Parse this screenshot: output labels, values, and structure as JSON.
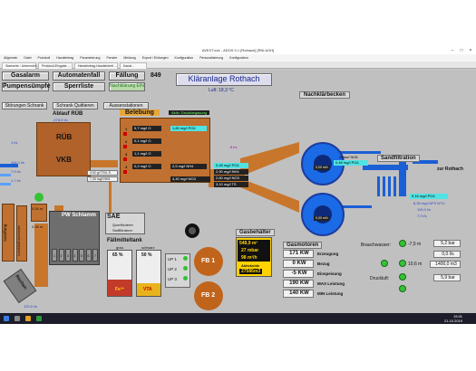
{
  "window": {
    "title": "AVEXT.exe - ADOS 9.1 [Rothach] [RNI AGH]",
    "menu": [
      "Allgemein",
      "Datei",
      "Protokoll",
      "Handeintrag",
      "Parameterung",
      "Fenster",
      "Meldung",
      "Export / Einfuegen",
      "Konfiguration",
      "Personalisierung",
      "Konfiguration"
    ],
    "tabs": [
      "Startseite / Uebersicht ...",
      "Protokoll-Eingabe ...",
      "Handeintrag-Handeinheit ...",
      "Kanal..."
    ]
  },
  "scada": {
    "buttons": {
      "gasalarm": "Gasalarm",
      "automatenfall": "Automatenfall",
      "faellung": "Fällung",
      "faellung_count": "849",
      "pumpensuempfe": "Pumpensümpfe",
      "sperrliste": "Sperrliste",
      "nachklaerung_ein": "Nachklärung EIN",
      "stoerungen": "Störungen Schrank",
      "schrank_quittieren": "Schrank Quittieren",
      "aussenstationen": "Aussenstationen"
    },
    "title": "Kläranlage Rothach",
    "luft": "Luft: 18,3 °C",
    "nachklaerbecken": "Nachklärbecken",
    "ablauf_rueb": "Ablauf RÜB",
    "ablauf_rueb_val": "-278,0 l/s",
    "rueb": "RÜB",
    "vkb": "VKB",
    "belebung": "Belebung",
    "belebung_state": "Aktiv: Druckbegasung",
    "left_vals": [
      "1 l/s",
      "119,0 l/s",
      "7,9 l/s",
      "1,7 l/s"
    ],
    "vkb_vals": [
      "3,92 g/l TS/L S",
      "7,30 mg/l NH4"
    ],
    "beleb_rows": [
      {
        "no": "1",
        "left": "9,7 mg/l O",
        "right": "1,80 mg/l PO4"
      },
      {
        "no": "2",
        "left": "0,1 mg/l O",
        "right": ""
      },
      {
        "no": "3",
        "left": "1,1 mg/l O",
        "right": ""
      },
      {
        "no": "4",
        "left": "0,2 mg/l O",
        "right": "2,5 mg/l NH4"
      }
    ],
    "beleb_extra": "4,40 mg/l NO3",
    "mid_vals": [
      "0,48 mg/l PO4",
      "2,90 mg/l NH4",
      "2,80 mg/l NO3",
      "3,10 mg/l TS"
    ],
    "side_val": "8 l/s",
    "becken1": "0,00 m/h",
    "becken2": "0,00 m/h",
    "ablauf_nkb": "Ablauf NKB",
    "ablauf_nkb_val": "0,48 mg/l PO4",
    "sandfiltration": "Sandfiltration",
    "zur_rothach": "zur Rothach",
    "right_vals": [
      "9,16 mg/l PO4",
      "8,35 mg/l AFS NTU",
      "119,0 l/s",
      "7,9 l/s"
    ],
    "pw_schlamm": "PW Schlamm",
    "pw_level": "0,34 m",
    "pw_level2": "0,26 m",
    "sae": "SAE",
    "sae_items": [
      "Querförderer",
      "Stoffförderer"
    ],
    "faellmittel": "Fällmitteltank",
    "grau": "grau",
    "schwarz": "schwarz",
    "pct_grau": "65 %",
    "pct_schwarz": "50 %",
    "fe": "Fe³⁺",
    "vta": "VTA",
    "up": [
      "UP 1",
      "UP 2",
      "UP 3"
    ],
    "fb1": "FB 1",
    "fb2": "FB 2",
    "gasbehaelter": "Gasbehälter",
    "gas_vals": [
      "548,9 m³",
      "27 mbar",
      "98 m³/h"
    ],
    "aktivkohle": "Aktivkohle",
    "aktivkohle_val": "27586m3",
    "gasmotoren": "Gasmotoren",
    "motor_rows": [
      {
        "val": "171 KW",
        "label": "Erzeugung"
      },
      {
        "val": "0 KW",
        "label": "Bezug"
      },
      {
        "val": "-5 KW",
        "label": "Einspeisung"
      },
      {
        "val": "190 KW",
        "label": "MAX Leistung"
      },
      {
        "val": "140 KW",
        "label": "MIN Leistung"
      }
    ],
    "brauchwasser": "Brauchwasser:",
    "bw_level": "-7,5 m",
    "bw_bar": "5,2 bar",
    "bw_ls": "0,0 l/s",
    "bw_m": "10,6 m",
    "bw_m3": "1400,0 m3",
    "druckluft": "Druckluft:",
    "dl_bar": "5,9 bar",
    "rechen": "Rechen",
    "sandfang": "Sandfang",
    "leicht": "Leichtstoff-abscheider",
    "bottom_val": "120,0 l/s",
    "pw_labels": [
      "1",
      "2",
      "3",
      "4",
      "5",
      "6",
      "7"
    ]
  },
  "taskbar": {
    "time": "15:01",
    "date": "21.10.2019"
  }
}
